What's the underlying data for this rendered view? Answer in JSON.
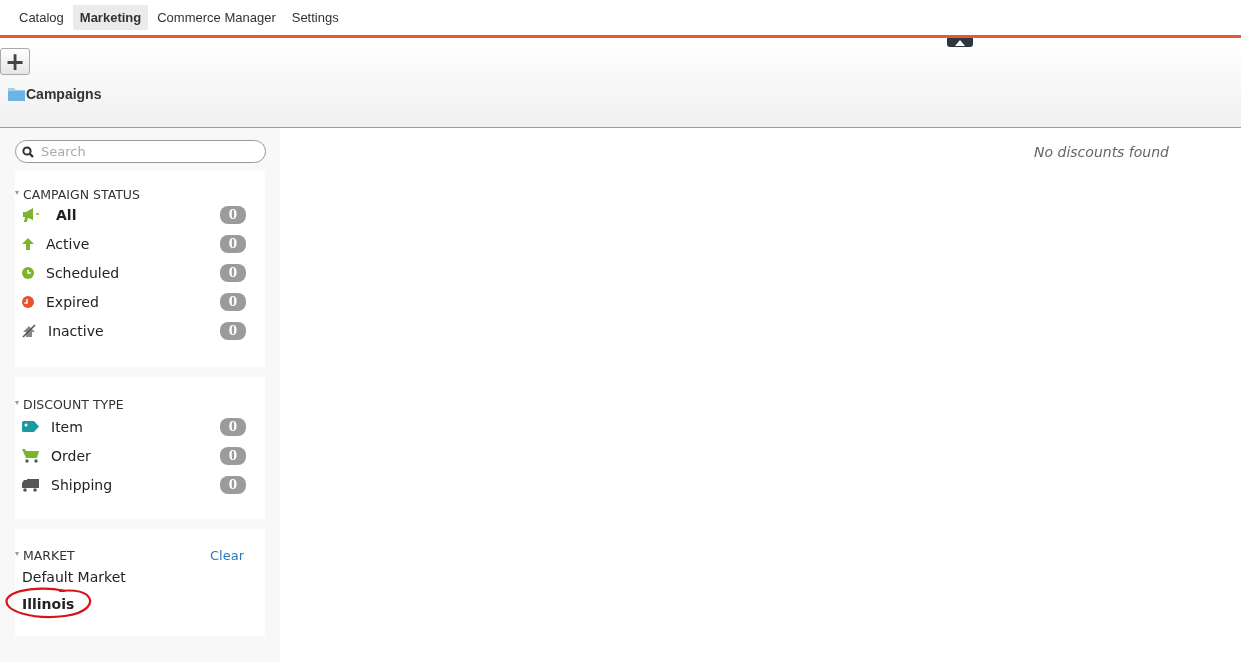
{
  "tabs": [
    {
      "label": "Catalog",
      "selected": false
    },
    {
      "label": "Marketing",
      "selected": true
    },
    {
      "label": "Commerce Manager",
      "selected": false
    },
    {
      "label": "Settings",
      "selected": false
    }
  ],
  "header": {
    "add_button": "+",
    "title": "Campaigns"
  },
  "search": {
    "placeholder": "Search"
  },
  "campaign_status": {
    "heading": "CAMPAIGN STATUS",
    "items": [
      {
        "kind": "all",
        "label": "All",
        "count": "0",
        "selected": true
      },
      {
        "kind": "active",
        "label": "Active",
        "count": "0",
        "selected": false
      },
      {
        "kind": "scheduled",
        "label": "Scheduled",
        "count": "0",
        "selected": false
      },
      {
        "kind": "expired",
        "label": "Expired",
        "count": "0",
        "selected": false
      },
      {
        "kind": "inactive",
        "label": "Inactive",
        "count": "0",
        "selected": false
      }
    ]
  },
  "discount_type": {
    "heading": "DISCOUNT TYPE",
    "items": [
      {
        "kind": "item",
        "label": "Item",
        "count": "0"
      },
      {
        "kind": "order",
        "label": "Order",
        "count": "0"
      },
      {
        "kind": "shipping",
        "label": "Shipping",
        "count": "0"
      }
    ]
  },
  "market": {
    "heading": "MARKET",
    "clear": "Clear",
    "items": [
      {
        "label": "Default Market",
        "selected": false,
        "circled": false
      },
      {
        "label": "Illinois",
        "selected": true,
        "circled": true
      }
    ]
  },
  "main": {
    "empty_message": "No discounts found"
  }
}
